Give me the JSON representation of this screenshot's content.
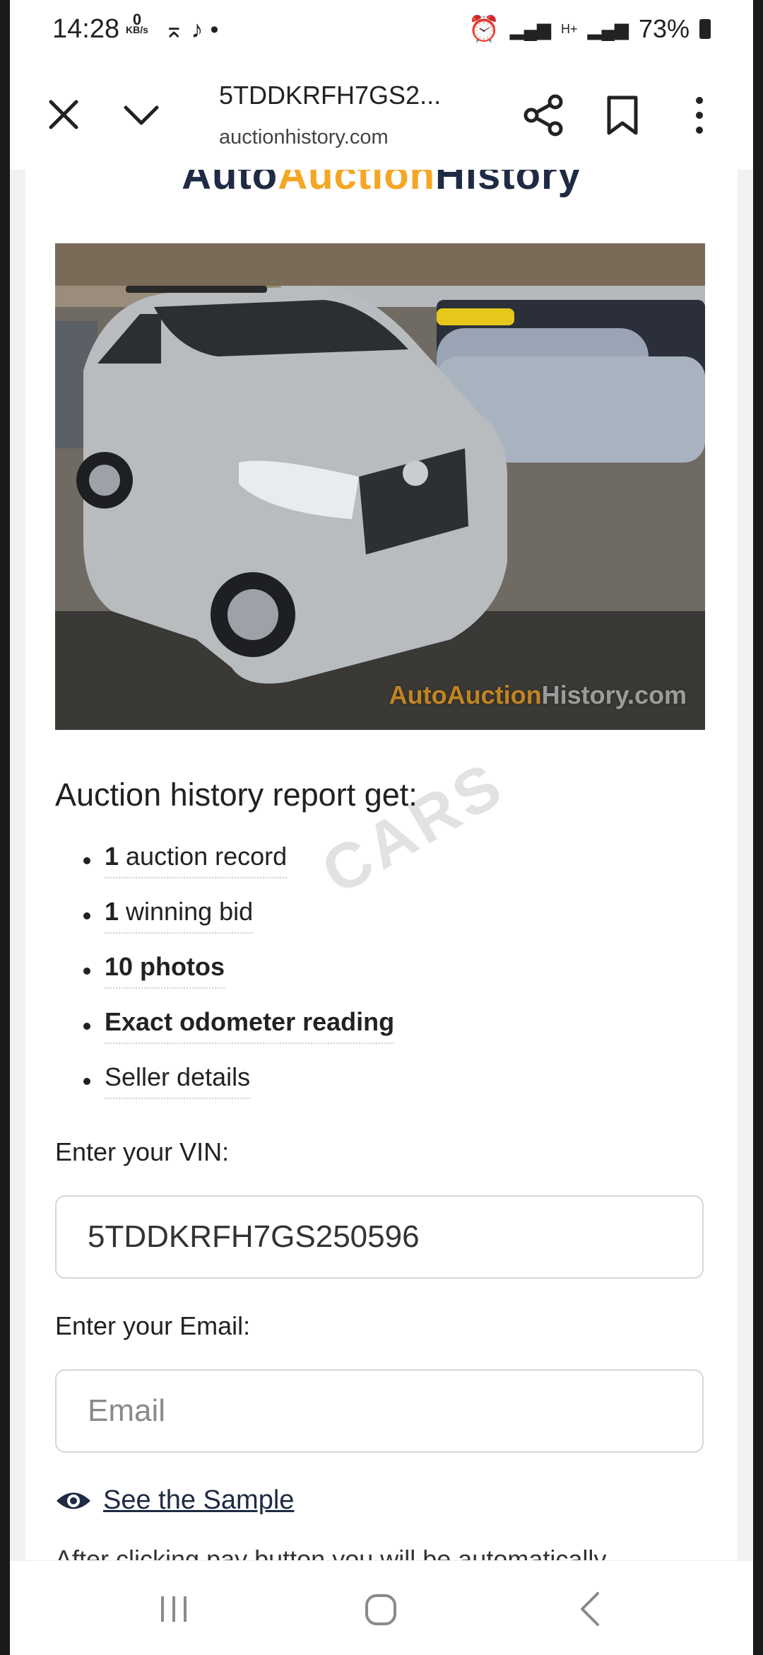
{
  "status_bar": {
    "time": "14:28",
    "net_speed_value": "0",
    "net_speed_unit": "KB/s",
    "network_labels": "H+",
    "battery": "73%"
  },
  "browser": {
    "page_title": "5TDDKRFH7GS2...",
    "url": "auctionhistory.com"
  },
  "site": {
    "logo_part1": "Auto",
    "logo_part2": "Auction",
    "logo_part3": "History",
    "photo_watermark_1": "AutoAuction",
    "photo_watermark_2": "History.com",
    "overlay_watermark": "CARS"
  },
  "report": {
    "heading": "Auction history report get:",
    "items": [
      {
        "bold": "1",
        "text": " auction record"
      },
      {
        "bold": "1",
        "text": " winning bid"
      },
      {
        "bold": "10 photos",
        "text": ""
      },
      {
        "bold": "Exact odometer reading",
        "text": ""
      },
      {
        "bold": "",
        "text": "Seller details"
      }
    ]
  },
  "form": {
    "vin_label": "Enter your VIN:",
    "vin_value": "5TDDKRFH7GS250596",
    "email_label": "Enter your Email:",
    "email_placeholder": "Email",
    "sample_link": "See the Sample",
    "after_text": "After clicking pay button you will be automatically"
  },
  "colors": {
    "brand_navy": "#1f2a44",
    "brand_orange": "#f5a623"
  },
  "icons": [
    "close-icon",
    "chevron-down-icon",
    "share-icon",
    "bookmark-icon",
    "more-vert-icon",
    "eye-icon",
    "nav-recents-icon",
    "nav-home-icon",
    "nav-back-icon"
  ]
}
